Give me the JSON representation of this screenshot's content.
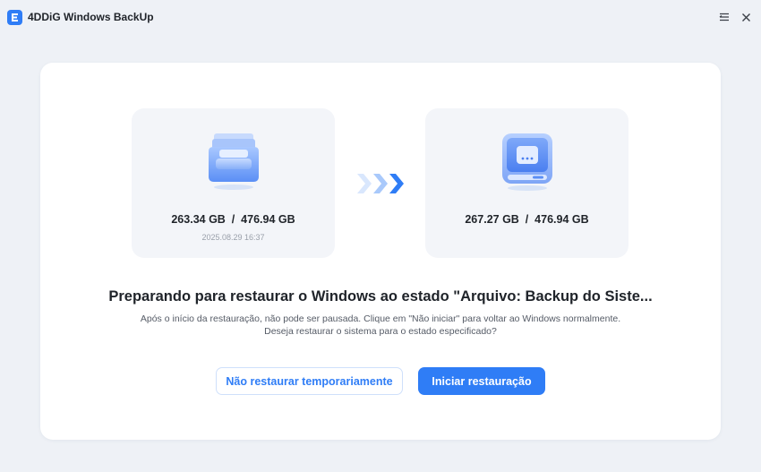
{
  "window": {
    "title": "4DDiG Windows BackUp",
    "logo_icon": "app-logo-icon",
    "menu_icon": "menu-icon",
    "close_icon": "close-icon"
  },
  "source": {
    "size": "263.34 GB  /  476.94 GB",
    "date": "2025.08.29 16:37",
    "icon": "backup-drive-icon"
  },
  "target": {
    "size": "267.27 GB  /  476.94 GB",
    "icon": "local-disk-icon"
  },
  "transfer_icon": "arrow-right-icon",
  "heading": "Preparando para restaurar o Windows ao estado \"Arquivo: Backup do Siste...",
  "description": {
    "line1": "Após o início da restauração, não pode ser pausada. Clique em \"Não iniciar\" para voltar ao Windows normalmente.",
    "line2": "Deseja restaurar o sistema para o estado especificado?"
  },
  "buttons": {
    "secondary": "Não restaurar temporariamente",
    "primary": "Iniciar restauração"
  },
  "colors": {
    "accent": "#2f7df6",
    "background": "#eef1f6",
    "card": "#ffffff",
    "panel": "#f3f5f9"
  }
}
